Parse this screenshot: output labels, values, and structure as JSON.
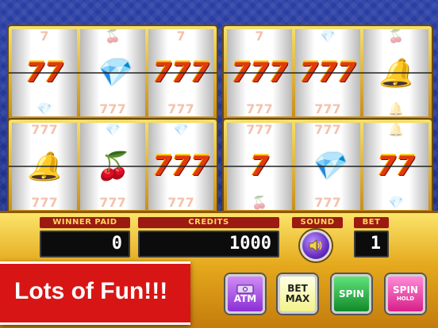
{
  "machines": [
    {
      "reels": [
        {
          "ghost_top": "7",
          "symbol": "77",
          "symbol_type": "seven",
          "ghost_bottom": "💎"
        },
        {
          "ghost_top": "🍒",
          "symbol": "💎",
          "symbol_type": "diamond",
          "ghost_bottom": "777"
        },
        {
          "ghost_top": "7",
          "symbol": "777",
          "symbol_type": "seven",
          "ghost_bottom": "777"
        }
      ]
    },
    {
      "reels": [
        {
          "ghost_top": "7",
          "symbol": "777",
          "symbol_type": "seven",
          "ghost_bottom": "777"
        },
        {
          "ghost_top": "💎",
          "symbol": "777",
          "symbol_type": "seven",
          "ghost_bottom": "777"
        },
        {
          "ghost_top": "🍒",
          "symbol": "🔔",
          "symbol_type": "bell",
          "ghost_bottom": "🔔"
        }
      ]
    },
    {
      "reels": [
        {
          "ghost_top": "777",
          "symbol": "🔔",
          "symbol_type": "bell",
          "ghost_bottom": "777"
        },
        {
          "ghost_top": "💎",
          "symbol": "🍒",
          "symbol_type": "cherry",
          "ghost_bottom": "777"
        },
        {
          "ghost_top": "💎",
          "symbol": "777",
          "symbol_type": "seven",
          "ghost_bottom": "777"
        }
      ]
    },
    {
      "reels": [
        {
          "ghost_top": "777",
          "symbol": "7",
          "symbol_type": "seven",
          "ghost_bottom": "🍒"
        },
        {
          "ghost_top": "777",
          "symbol": "💎",
          "symbol_type": "diamond",
          "ghost_bottom": "777"
        },
        {
          "ghost_top": "🔔",
          "symbol": "77",
          "symbol_type": "seven",
          "ghost_bottom": "💎"
        }
      ]
    }
  ],
  "panel": {
    "winner_paid_label": "WINNER PAID",
    "winner_paid_value": "0",
    "credits_label": "CREDITS",
    "credits_value": "1000",
    "sound_label": "SOUND",
    "bet_label": "BET",
    "bet_value": "1"
  },
  "buttons": {
    "atm_label": "ATM",
    "atm_icon": "money-icon",
    "bet_max_line1": "BET",
    "bet_max_line2": "MAX",
    "spin_label": "SPIN",
    "spin_hold_line1": "SPIN",
    "spin_hold_line2": "HOLD"
  },
  "banner": {
    "text": "Lots of Fun!!!"
  },
  "colors": {
    "banner_red": "#d81515",
    "label_red": "#9b1a12",
    "gold": "#e5a91d",
    "background_blue": "#1a2a7a"
  }
}
